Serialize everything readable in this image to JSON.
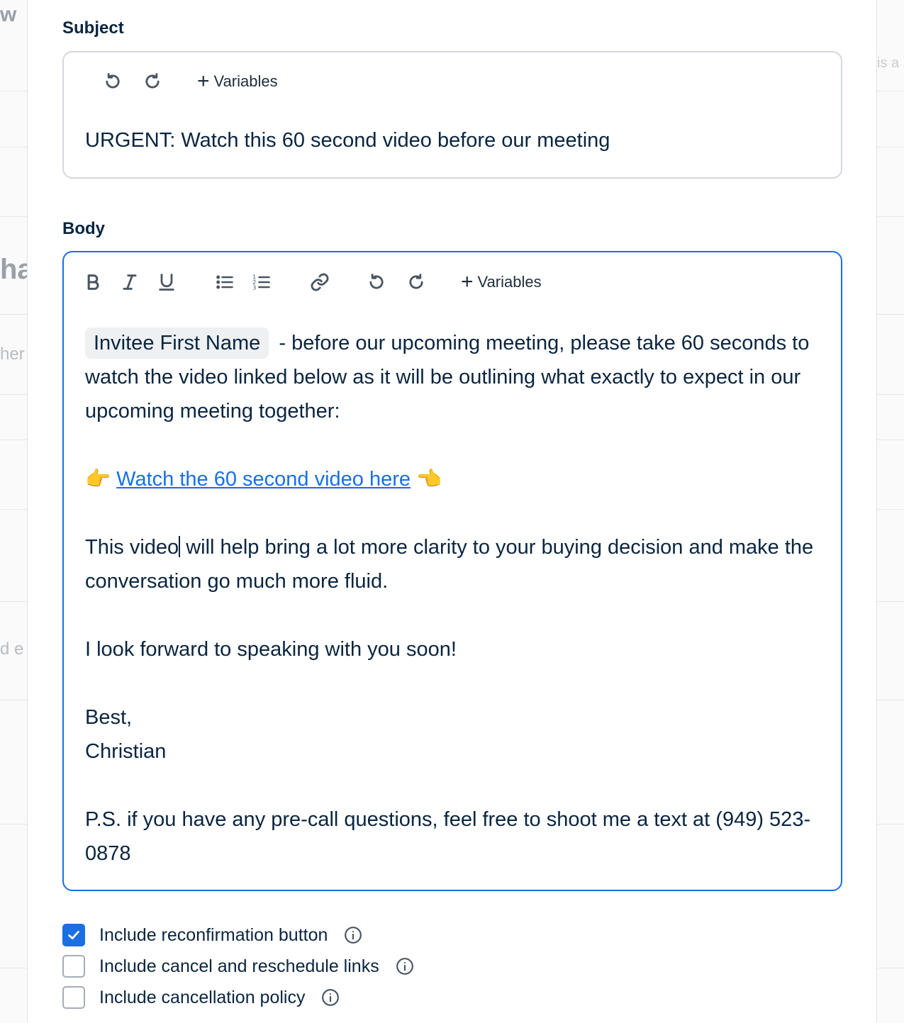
{
  "background": {
    "left_fragments": [
      "w",
      "ha",
      "her",
      "d e"
    ],
    "right_fragments": [
      "is a"
    ]
  },
  "subject": {
    "label": "Subject",
    "toolbar": {
      "variables_label": "Variables"
    },
    "value": "URGENT: Watch this 60 second video before our meeting"
  },
  "body": {
    "label": "Body",
    "toolbar": {
      "variables_label": "Variables"
    },
    "chip": "Invitee First Name",
    "para1": " - before our upcoming meeting, please take 60 seconds to watch the video linked below as it will be outlining what exactly to expect in our upcoming meeting together:",
    "emoji_left": "👉",
    "link_text": "Watch the 60 second video here",
    "emoji_right": "👈",
    "para2_a": "This video",
    "para2_b": " will help bring a lot more clarity to your buying decision and make the conversation go much more fluid.",
    "para3": "I look forward to speaking with you soon!",
    "sign_off": "Best,",
    "signature": "Christian",
    "ps": "P.S. if you have any pre-call questions, feel free to shoot me a text at (949) 523-0878"
  },
  "options": [
    {
      "label": "Include reconfirmation button",
      "checked": true
    },
    {
      "label": "Include cancel and reschedule links",
      "checked": false
    },
    {
      "label": "Include cancellation policy",
      "checked": false
    }
  ],
  "colors": {
    "accent": "#1a6fe3",
    "text": "#0a2540",
    "border": "#d4d8de"
  }
}
